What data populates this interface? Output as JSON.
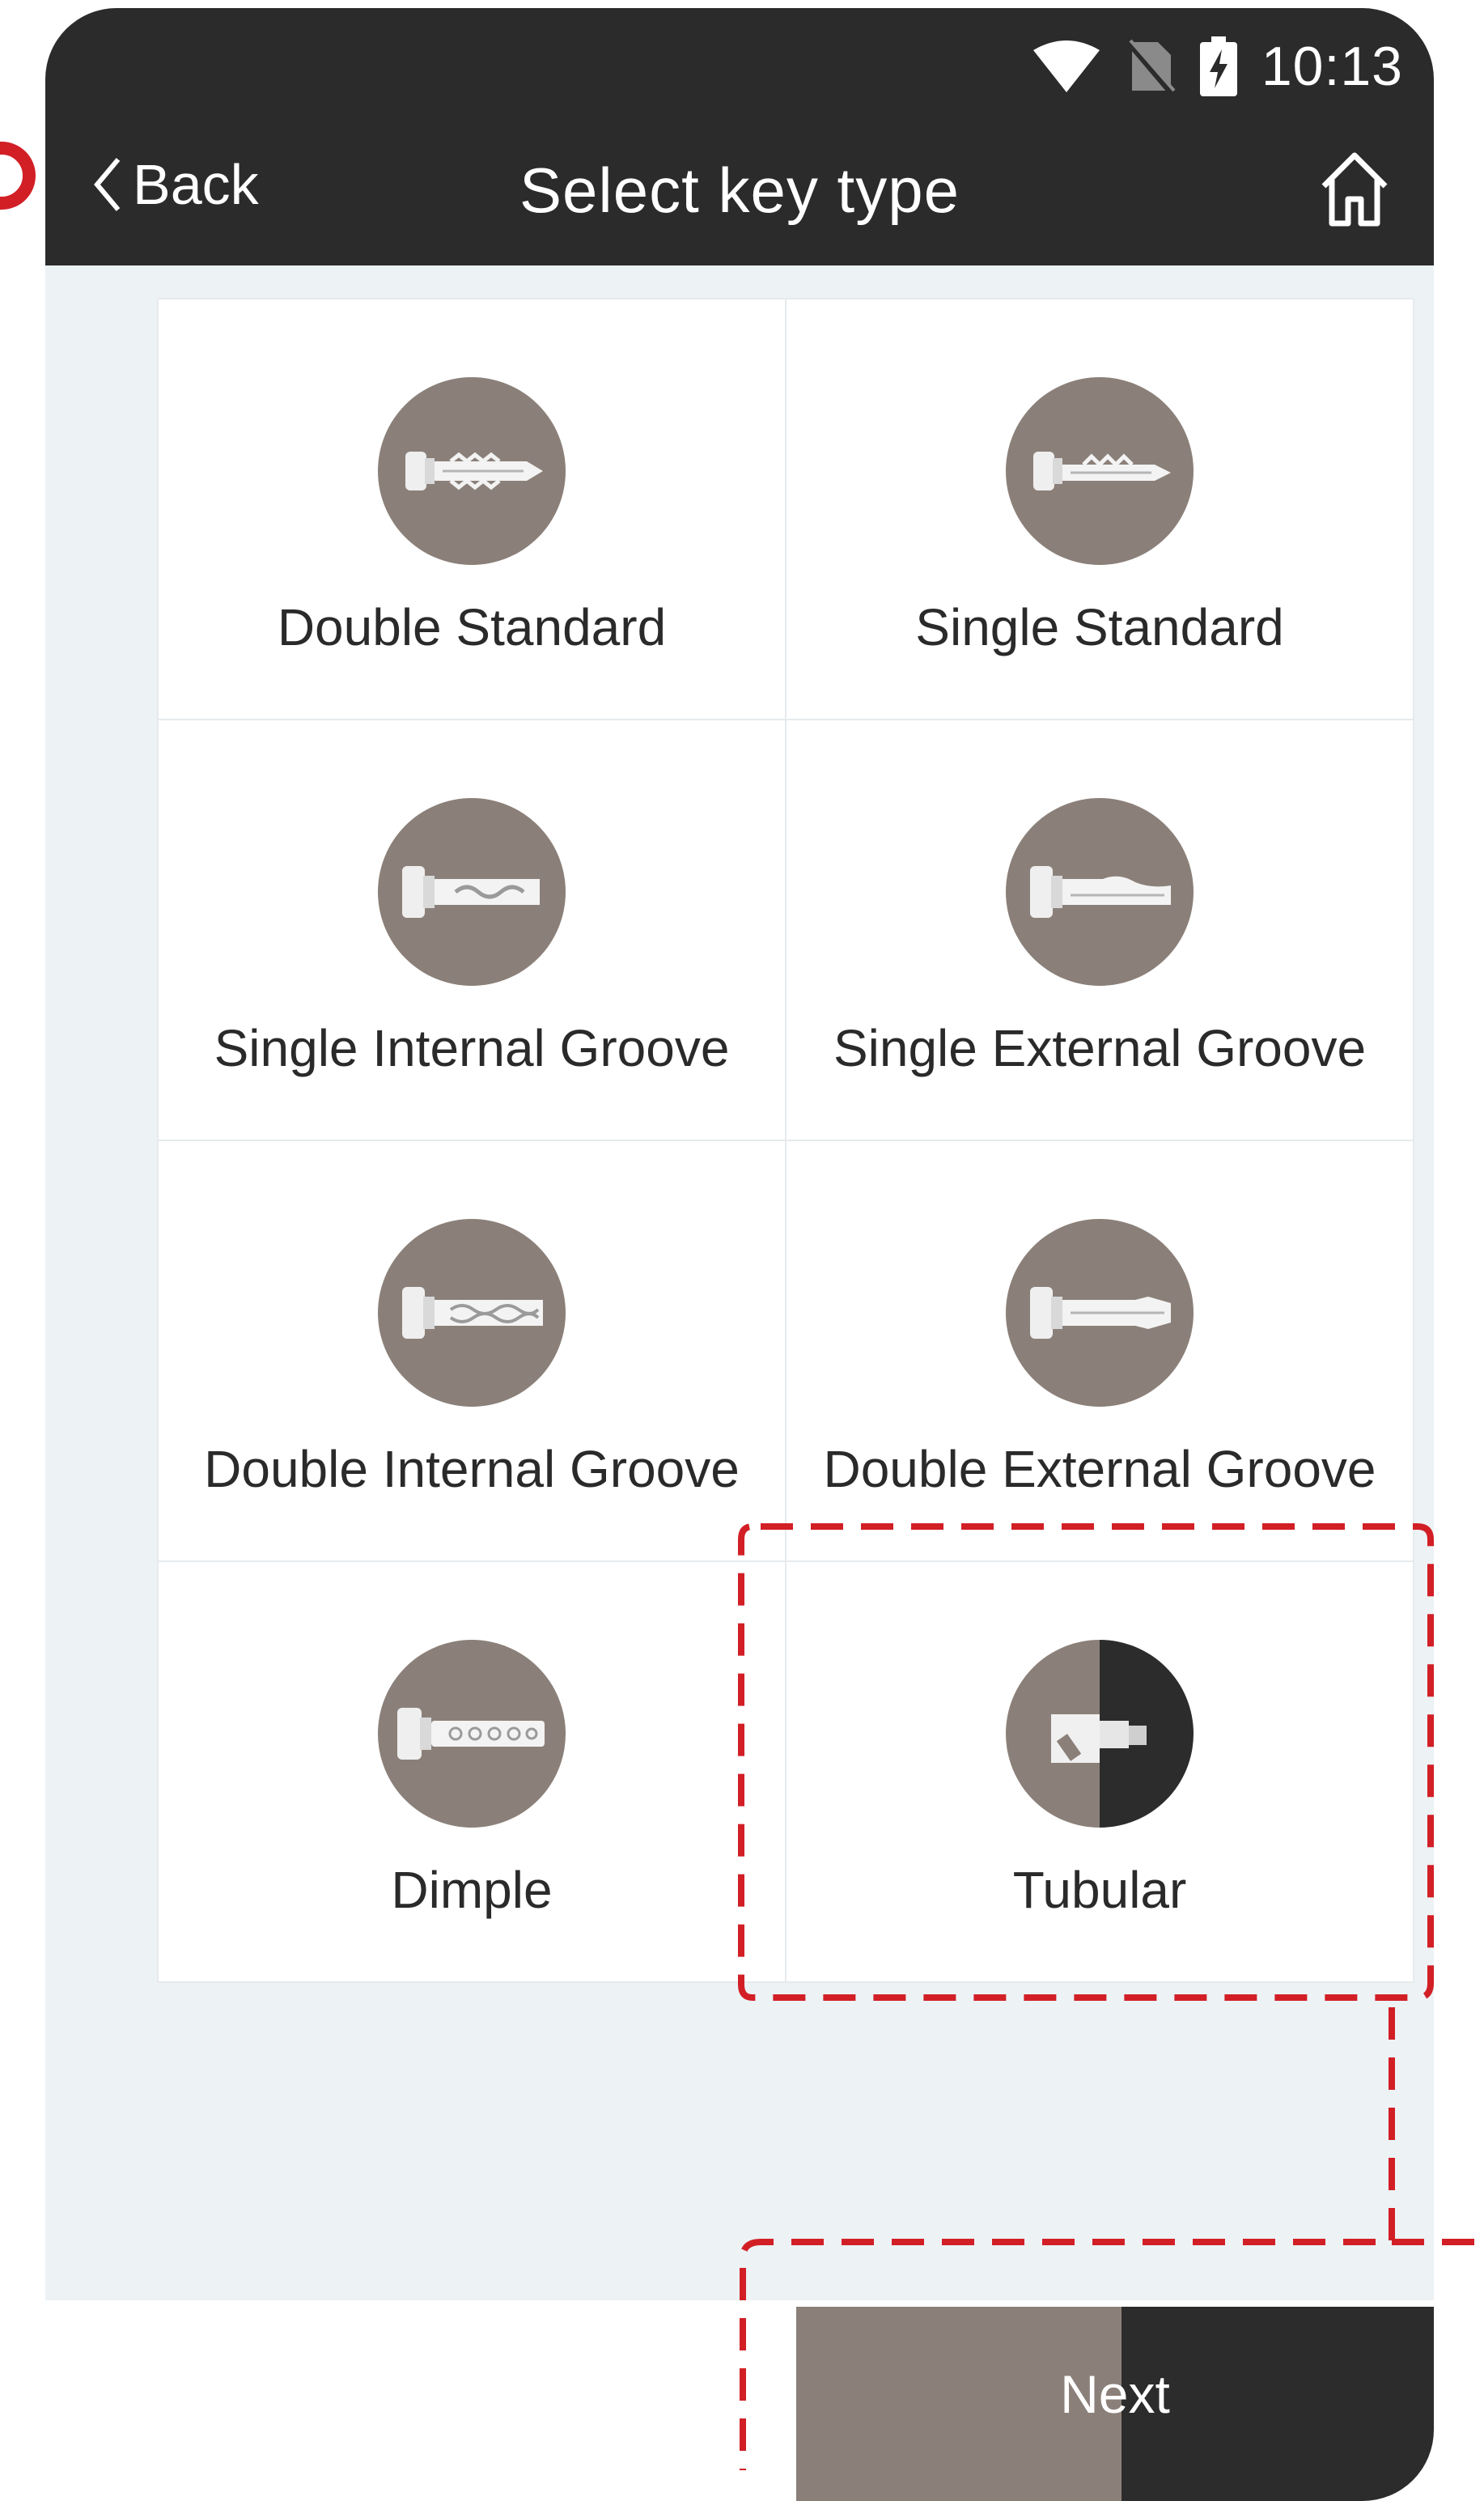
{
  "status_bar": {
    "time": "10:13",
    "icons": [
      "wifi-icon",
      "no-sim-icon",
      "battery-charging-icon"
    ]
  },
  "nav": {
    "back_label": "Back",
    "title": "Select key type",
    "home_icon": "home-icon"
  },
  "key_types": [
    {
      "label": "Double Standard",
      "icon": "double-standard-key-icon"
    },
    {
      "label": "Single Standard",
      "icon": "single-standard-key-icon"
    },
    {
      "label": "Single Internal Groove",
      "icon": "single-internal-groove-key-icon"
    },
    {
      "label": "Single External Groove",
      "icon": "single-external-groove-key-icon"
    },
    {
      "label": "Double Internal Groove",
      "icon": "double-internal-groove-key-icon"
    },
    {
      "label": "Double External Groove",
      "icon": "double-external-groove-key-icon"
    },
    {
      "label": "Dimple",
      "icon": "dimple-key-icon"
    },
    {
      "label": "Tubular",
      "icon": "tubular-key-icon",
      "selected": true
    }
  ],
  "footer": {
    "next_label": "Next"
  },
  "colors": {
    "header": "#2b2b2b",
    "icon_circle": "#8b8079",
    "selected_dark": "#2c2c2c",
    "annotation_red": "#d21f26",
    "background": "#edf2f5"
  }
}
